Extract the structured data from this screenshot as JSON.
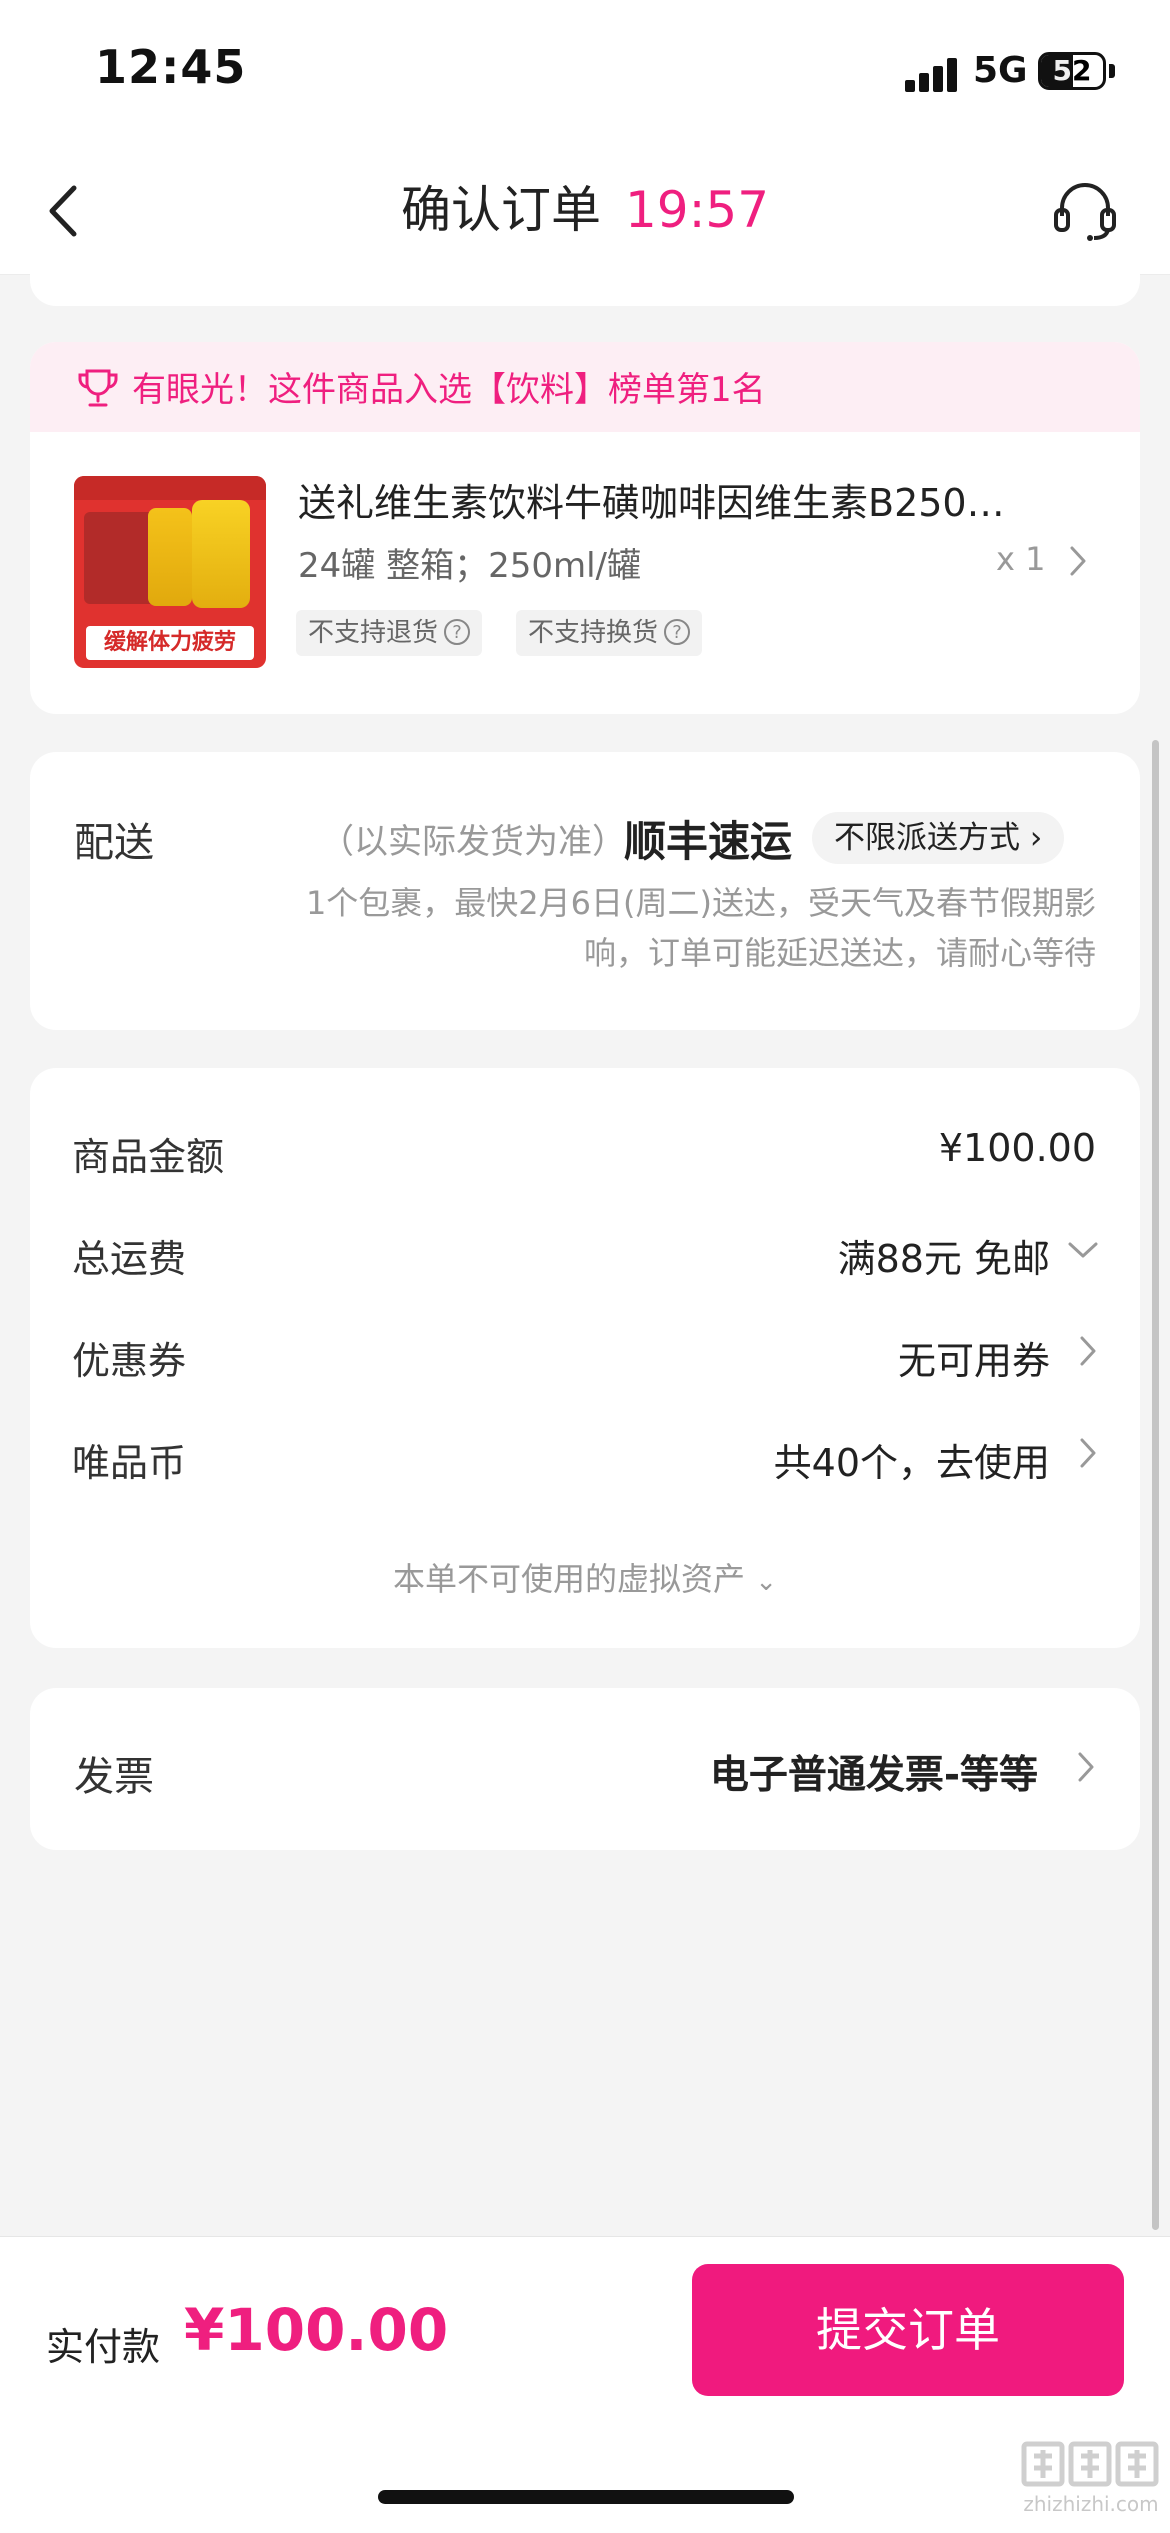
{
  "status_bar": {
    "time": "12:45",
    "network": "5G",
    "battery": "52",
    "battery_level": 0.52
  },
  "nav": {
    "title": "确认订单",
    "timer": "19:57"
  },
  "rank_banner": {
    "text": "有眼光！这件商品入选【饮料】榜单第1名"
  },
  "product": {
    "name": "送礼维生素饮料牛磺咖啡因维生素B250…",
    "spec": "24罐 整箱；250ml/罐",
    "quantity": "x 1",
    "image_badge": "缓解体力疲劳",
    "tags": [
      "不支持退货",
      "不支持换货"
    ]
  },
  "delivery": {
    "label": "配送",
    "note": "（以实际发货为准）",
    "carrier": "顺丰速运",
    "method": "不限派送方式",
    "eta_line1": "1个包裹，最快2月6日(周二)送达，受天气及春节假期影",
    "eta_line2": "响，订单可能延迟送达，请耐心等待"
  },
  "price": {
    "goods_label": "商品金额",
    "goods_value": "¥100.00",
    "shipping_label": "总运费",
    "shipping_value": "满88元 免邮",
    "coupon_label": "优惠券",
    "coupon_value": "无可用券",
    "coin_label": "唯品币",
    "coin_value": "共40个，去使用",
    "virtual_assets": "本单不可使用的虚拟资产"
  },
  "invoice": {
    "label": "发票",
    "value": "电子普通发票-等等"
  },
  "bottom": {
    "pay_label": "实付款",
    "pay_amount": "¥100.00",
    "submit": "提交订单"
  },
  "watermark": {
    "text": "zhizhizhi.com"
  },
  "colors": {
    "accent": "#ef1f7f",
    "button": "#f01a7e"
  }
}
